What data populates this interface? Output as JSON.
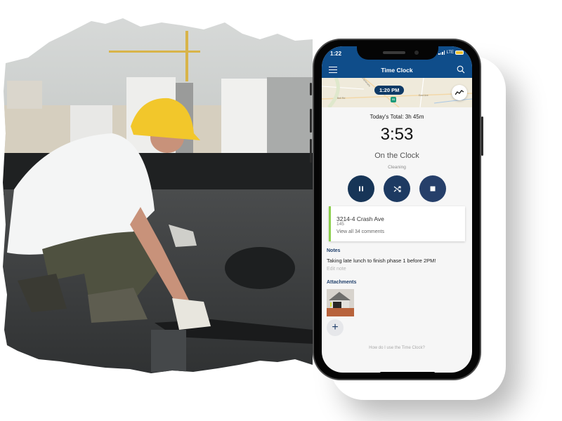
{
  "background": {
    "description": "Roofer in yellow hard hat applying roofing membrane on a rooftop with city buildings and crane behind",
    "colors": {
      "sky": "#cfd2d1",
      "roof": "#3b3d3e",
      "hardhat": "#f2c72b",
      "shirt": "#f4f5f5"
    }
  },
  "phone": {
    "status_bar": {
      "time": "1:22",
      "network": "LTE"
    },
    "header": {
      "title": "Time Clock",
      "menu_icon": "hamburger-menu-icon",
      "search_icon": "search-icon"
    },
    "map": {
      "time_marker": "1:20 PM",
      "pin_label": "95",
      "street_labels": [
        "Bell Rd",
        "East Ave",
        "Esplanade"
      ],
      "trend_icon": "trend-line-icon"
    },
    "todays_total": "Today's Total: 3h 45m",
    "elapsed": "3:53",
    "status": "On the Clock",
    "task": "Cleaning",
    "controls": [
      {
        "name": "pause",
        "icon": "pause-icon"
      },
      {
        "name": "switch",
        "icon": "shuffle-icon"
      },
      {
        "name": "stop",
        "icon": "stop-icon"
      }
    ],
    "job": {
      "address": "3214-4 Crash Ave",
      "number": "145",
      "comments_link": "View all 34 comments"
    },
    "notes": {
      "label": "Notes",
      "body": "Taking late lunch to finish phase 1 before 2PM!",
      "edit_label": "Edit note"
    },
    "attachments": {
      "label": "Attachments",
      "add_symbol": "+"
    },
    "help_link": "How do I use the Time Clock?",
    "colors": {
      "header": "#0f4d8a",
      "button": "#1d3a62",
      "accent_green": "#8ccf4d",
      "section_label": "#1f3f6b"
    }
  }
}
